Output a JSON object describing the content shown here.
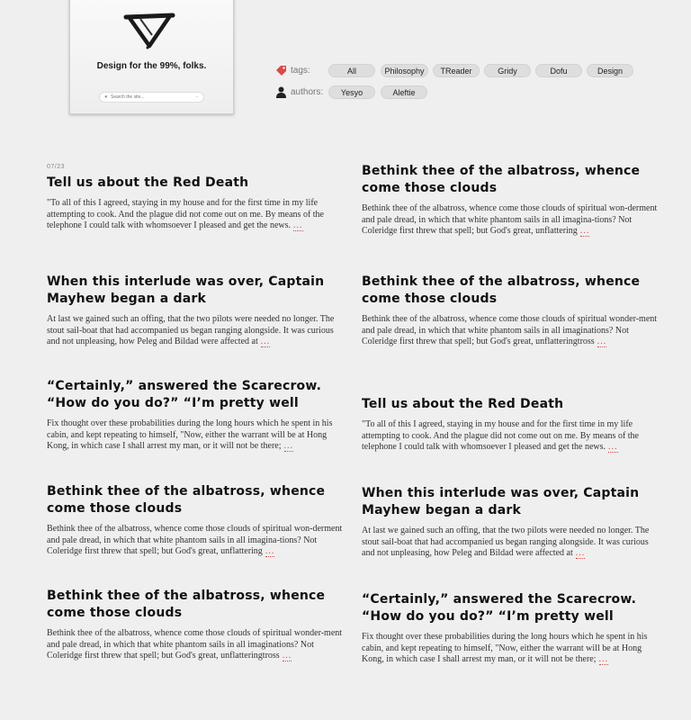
{
  "hero": {
    "tagline": "Design for the 99%, folks.",
    "search_placeholder": "Search the site...",
    "search_icon": "magnifier-icon",
    "logo_icon": "brush-triangle-logo"
  },
  "filters": {
    "tags_label": "tags:",
    "tags_icon": "tag-icon",
    "tags_icon_color": "#d94a4a",
    "tags": [
      "All",
      "Philosophy",
      "TReader",
      "Gridy",
      "Dofu",
      "Design"
    ],
    "authors_label": "authors:",
    "authors_icon": "user-icon",
    "authors": [
      "Yesyo",
      "Aleftie"
    ]
  },
  "articles": [
    {
      "date": "07/23",
      "title": "Tell us about the Red Death",
      "excerpt": "\"To all of this I agreed, staying in my house and for the first time in  my life attempting to cook. And the plague did not come out on me. By  means of the telephone I could talk with whomsoever I pleased and get  the news.",
      "more": "..."
    },
    {
      "date": "",
      "title": "Bethink thee of the albatross, whence come those clouds",
      "excerpt": "Bethink thee of the albatross, whence come those clouds of spiritual won-derment and pale dread, in which that white phantom sails in all imagina-tions? Not Coleridge first threw that spell; but God's great, unflattering",
      "more": "..."
    },
    {
      "date": "",
      "title": "When this interlude was over, Captain Mayhew began a dark",
      "excerpt": "At last we gained such an offing, that the two pilots were needed no longer. The stout sail-boat that had accompanied us began ranging alongside. It was curious and not unpleasing, how Peleg and Bildad were affected at",
      "more": "..."
    },
    {
      "date": "",
      "title": "Bethink thee of the albatross, whence come those clouds",
      "excerpt": "Bethink thee of the albatross, whence come those clouds of spiritual wonder-ment and pale dread, in which that white phantom sails in all imaginations? Not Coleridge first threw that spell; but God's great, unflatteringtross",
      "more": "..."
    },
    {
      "date": "",
      "title": "“Certainly,” answered the Scarecrow. “How do you do?” “I’m pretty well",
      "excerpt": "Fix thought over these probabilities during the long hours which he spent in his cabin, and kept repeating to himself, \"Now, either the warrant will be at Hong Kong, in which case I shall arrest my man, or it will not be there;",
      "more": "..."
    },
    {
      "date": "",
      "title": "Tell us about the Red Death",
      "excerpt": "\"To all of this I agreed, staying in my house and for the first time in  my life attempting to cook. And the plague did not come out on me. By  means of the telephone I could talk with whomsoever I pleased and get  the news.",
      "more": "..."
    },
    {
      "date": "",
      "title": "Bethink thee of the albatross, whence come those clouds",
      "excerpt": "Bethink thee of the albatross, whence come those clouds of spiritual won-derment and pale dread, in which that white phantom sails in all imagina-tions? Not Coleridge first threw that spell; but God's great, unflattering",
      "more": "..."
    },
    {
      "date": "",
      "title": "When this interlude was over, Captain Mayhew began a dark",
      "excerpt": "At last we gained such an offing, that the two pilots were needed no longer. The stout sail-boat that had accompanied us began ranging alongside. It was curious and not unpleasing, how Peleg and Bildad were affected at",
      "more": "..."
    },
    {
      "date": "",
      "title": "Bethink thee of the albatross, whence come those clouds",
      "excerpt": "Bethink thee of the albatross, whence come those clouds of spiritual wonder-ment and pale dread, in which that white phantom sails in all imaginations? Not Coleridge first threw that spell; but God's great, unflatteringtross",
      "more": "..."
    },
    {
      "date": "",
      "title": "“Certainly,” answered the Scarecrow. “How do you do?” “I’m pretty well",
      "excerpt": "Fix thought over these probabilities during the long hours which he spent in his cabin, and kept repeating to himself, \"Now, either the warrant will be at Hong Kong, in which case I shall arrest my man, or it will not be there;",
      "more": "..."
    }
  ]
}
